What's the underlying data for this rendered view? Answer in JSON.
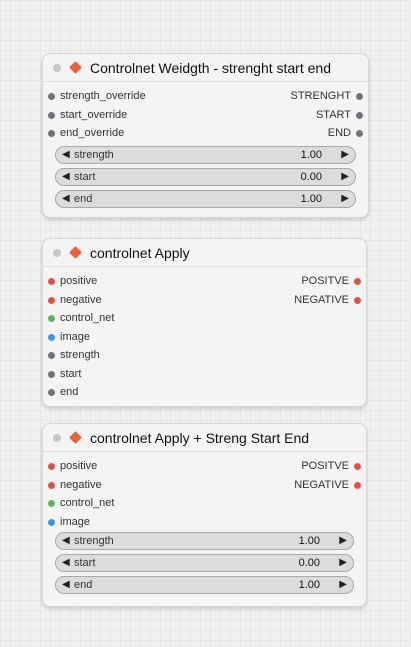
{
  "nodes": [
    {
      "title": "Controlnet Weidgth - strenght start end",
      "inputs": [
        {
          "label": "strength_override",
          "color": "#75707a"
        },
        {
          "label": "start_override",
          "color": "#75707a"
        },
        {
          "label": "end_override",
          "color": "#75707a"
        }
      ],
      "outputs": [
        {
          "label": "STRENGHT",
          "color": "#75707a"
        },
        {
          "label": "START",
          "color": "#75707a"
        },
        {
          "label": "END",
          "color": "#75707a"
        }
      ],
      "widgets": [
        {
          "label": "strength",
          "value": "1.00"
        },
        {
          "label": "start",
          "value": "0.00"
        },
        {
          "label": "end",
          "value": "1.00"
        }
      ]
    },
    {
      "title": "controlnet Apply",
      "inputs": [
        {
          "label": "positive",
          "color": "#d9544c"
        },
        {
          "label": "negative",
          "color": "#d9544c"
        },
        {
          "label": "control_net",
          "color": "#5fb45a"
        },
        {
          "label": "image",
          "color": "#3a9ad9"
        },
        {
          "label": "strength",
          "color": "#75707a"
        },
        {
          "label": "start",
          "color": "#75707a"
        },
        {
          "label": "end",
          "color": "#75707a"
        }
      ],
      "outputs": [
        {
          "label": "POSITVE",
          "color": "#d9544c"
        },
        {
          "label": "NEGATIVE",
          "color": "#d9544c"
        }
      ]
    },
    {
      "title": "controlnet Apply + Streng Start End",
      "inputs": [
        {
          "label": "positive",
          "color": "#d9544c"
        },
        {
          "label": "negative",
          "color": "#d9544c"
        },
        {
          "label": "control_net",
          "color": "#5fb45a"
        },
        {
          "label": "image",
          "color": "#3a9ad9"
        }
      ],
      "outputs": [
        {
          "label": "POSITVE",
          "color": "#d9544c"
        },
        {
          "label": "NEGATIVE",
          "color": "#d9544c"
        }
      ],
      "widgets": [
        {
          "label": "strength",
          "value": "1.00"
        },
        {
          "label": "start",
          "value": "0.00"
        },
        {
          "label": "end",
          "value": "1.00"
        }
      ]
    }
  ],
  "icons": {
    "arrow_left": "◀",
    "arrow_right": "▶"
  },
  "colors": {
    "node_icon": "#e8603c",
    "background": "#f0f0f0"
  }
}
